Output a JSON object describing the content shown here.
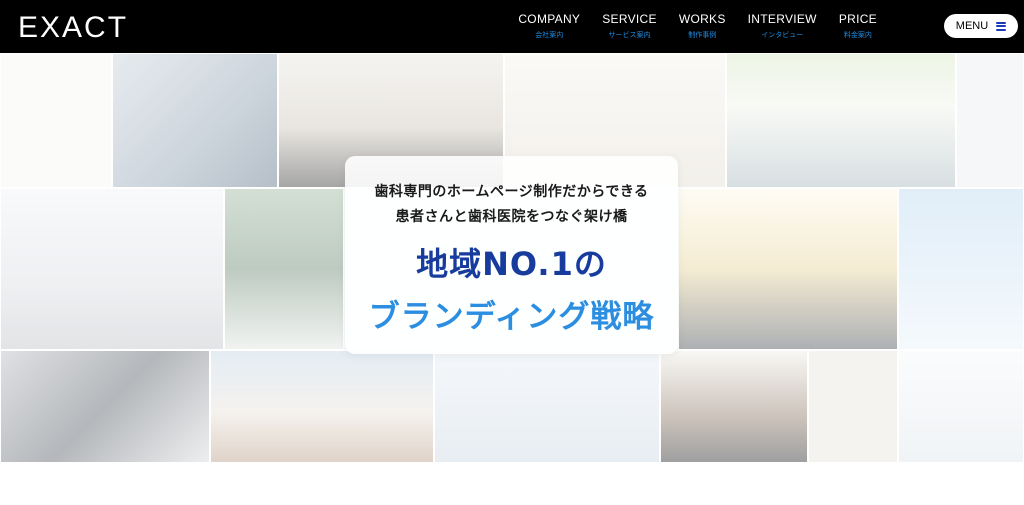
{
  "header": {
    "logo": "EXACT",
    "nav": [
      {
        "en": "COMPANY",
        "jp": "会社案内"
      },
      {
        "en": "SERVICE",
        "jp": "サービス案内"
      },
      {
        "en": "WORKS",
        "jp": "制作事例"
      },
      {
        "en": "INTERVIEW",
        "jp": "インタビュー"
      },
      {
        "en": "PRICE",
        "jp": "料金案内"
      }
    ],
    "menu_label": "MENU"
  },
  "hero": {
    "line1": "歯科専門のホームページ制作だからできる",
    "line2": "患者さんと歯科医院をつなぐ架け橋",
    "title1": "地域NO.1の",
    "title2": "ブランディング戦略"
  },
  "colors": {
    "header_bg": "#000000",
    "nav_sub": "#1e8fe6",
    "title_dark_blue": "#183b9e",
    "title_light_blue": "#2b8ee0",
    "menu_icon": "#1a3bb5"
  },
  "icons": [
    "hamburger-icon"
  ]
}
